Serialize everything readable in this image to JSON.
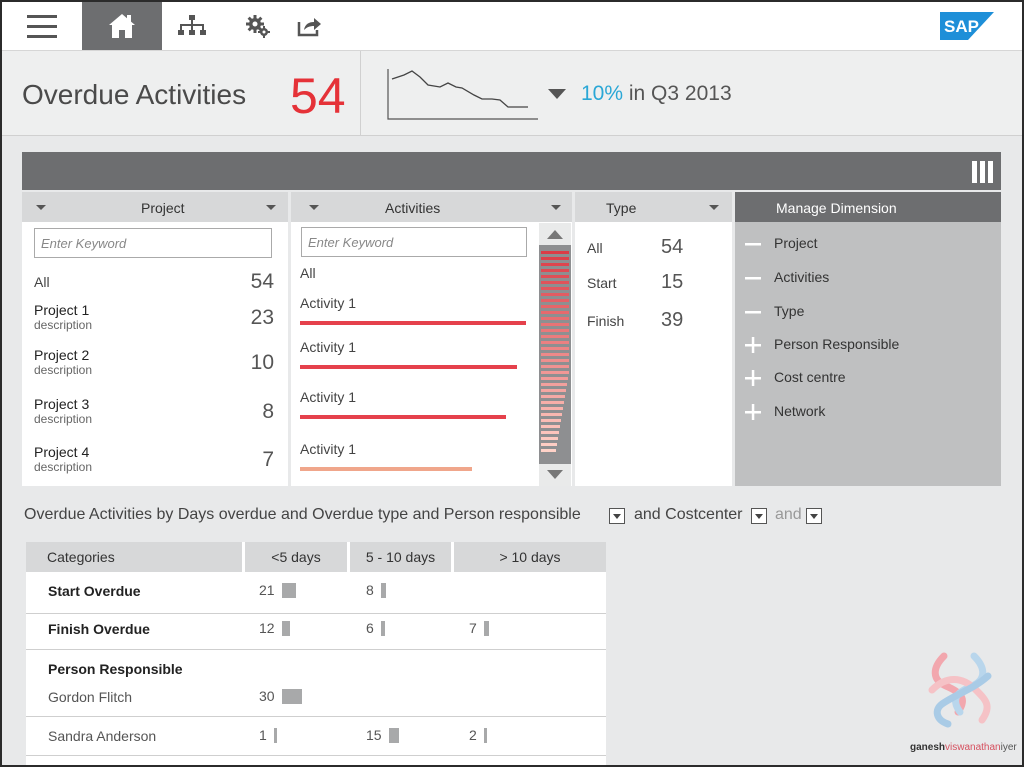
{
  "nav": {
    "items": [
      {
        "name": "menu",
        "icon": "hamburger-icon"
      },
      {
        "name": "home",
        "icon": "home-icon",
        "active": true
      },
      {
        "name": "hierarchy",
        "icon": "org-chart-icon"
      },
      {
        "name": "settings",
        "icon": "gear-icon"
      },
      {
        "name": "share",
        "icon": "share-icon"
      }
    ],
    "logo": "SAP"
  },
  "kpi": {
    "title": "Overdue Activities",
    "value": "54",
    "trend_direction": "down",
    "trend_pct": "10%",
    "trend_period": "in Q3 2013",
    "value_color": "#e53238",
    "pct_color": "#2aa7d6"
  },
  "project": {
    "header": "Project",
    "placeholder": "Enter Keyword",
    "all_label": "All",
    "all_count": "54",
    "rows": [
      {
        "name": "Project 1",
        "desc": "description",
        "count": "23"
      },
      {
        "name": "Project 2",
        "desc": "description",
        "count": "10"
      },
      {
        "name": "Project 3",
        "desc": "description",
        "count": "8"
      },
      {
        "name": "Project 4",
        "desc": "description",
        "count": "7"
      }
    ]
  },
  "activities": {
    "header": "Activities",
    "placeholder": "Enter Keyword",
    "all_label": "All",
    "rows": [
      {
        "label": "Activity 1",
        "level": 1.0,
        "color": "#e5414c"
      },
      {
        "label": "Activity 1",
        "level": 0.96,
        "color": "#e5414c"
      },
      {
        "label": "Activity 1",
        "level": 0.91,
        "color": "#e5414c"
      },
      {
        "label": "Activity 1",
        "level": 0.76,
        "color": "#f0a68b"
      }
    ]
  },
  "type": {
    "header": "Type",
    "rows": [
      {
        "label": "All",
        "value": "54"
      },
      {
        "label": "Start",
        "value": "15"
      },
      {
        "label": "Finish",
        "value": "39"
      }
    ]
  },
  "manage": {
    "header": "Manage Dimension",
    "items": [
      {
        "label": "Project",
        "sign": "minus"
      },
      {
        "label": "Activities",
        "sign": "minus"
      },
      {
        "label": "Type",
        "sign": "minus"
      },
      {
        "label": "Person Responsible",
        "sign": "plus"
      },
      {
        "label": "Cost centre",
        "sign": "plus"
      },
      {
        "label": "Network",
        "sign": "plus"
      }
    ]
  },
  "analysis": {
    "text1": "Overdue Activities by Days overdue and Overdue type and Person responsible",
    "text2": "and Costcenter",
    "text3": "and"
  },
  "table": {
    "columns": [
      "Categories",
      "<5 days",
      "5 - 10 days",
      "> 10 days"
    ],
    "rows": [
      {
        "label": "Start Overdue",
        "style": "bold",
        "values": [
          "21",
          "8",
          ""
        ]
      },
      {
        "label": "Finish Overdue",
        "style": "bold",
        "values": [
          "12",
          "6",
          "7"
        ]
      },
      {
        "label": "Person Responsible",
        "style": "bold",
        "values": [
          "",
          "",
          ""
        ]
      },
      {
        "label": "Gordon Flitch",
        "style": "sub",
        "values": [
          "30",
          "",
          ""
        ]
      },
      {
        "label": "Sandra Anderson",
        "style": "sub",
        "values": [
          "1",
          "15",
          "2"
        ]
      }
    ]
  },
  "watermark": {
    "first": "ganesh",
    "middle": "viswanathan",
    "last": "iyer"
  }
}
